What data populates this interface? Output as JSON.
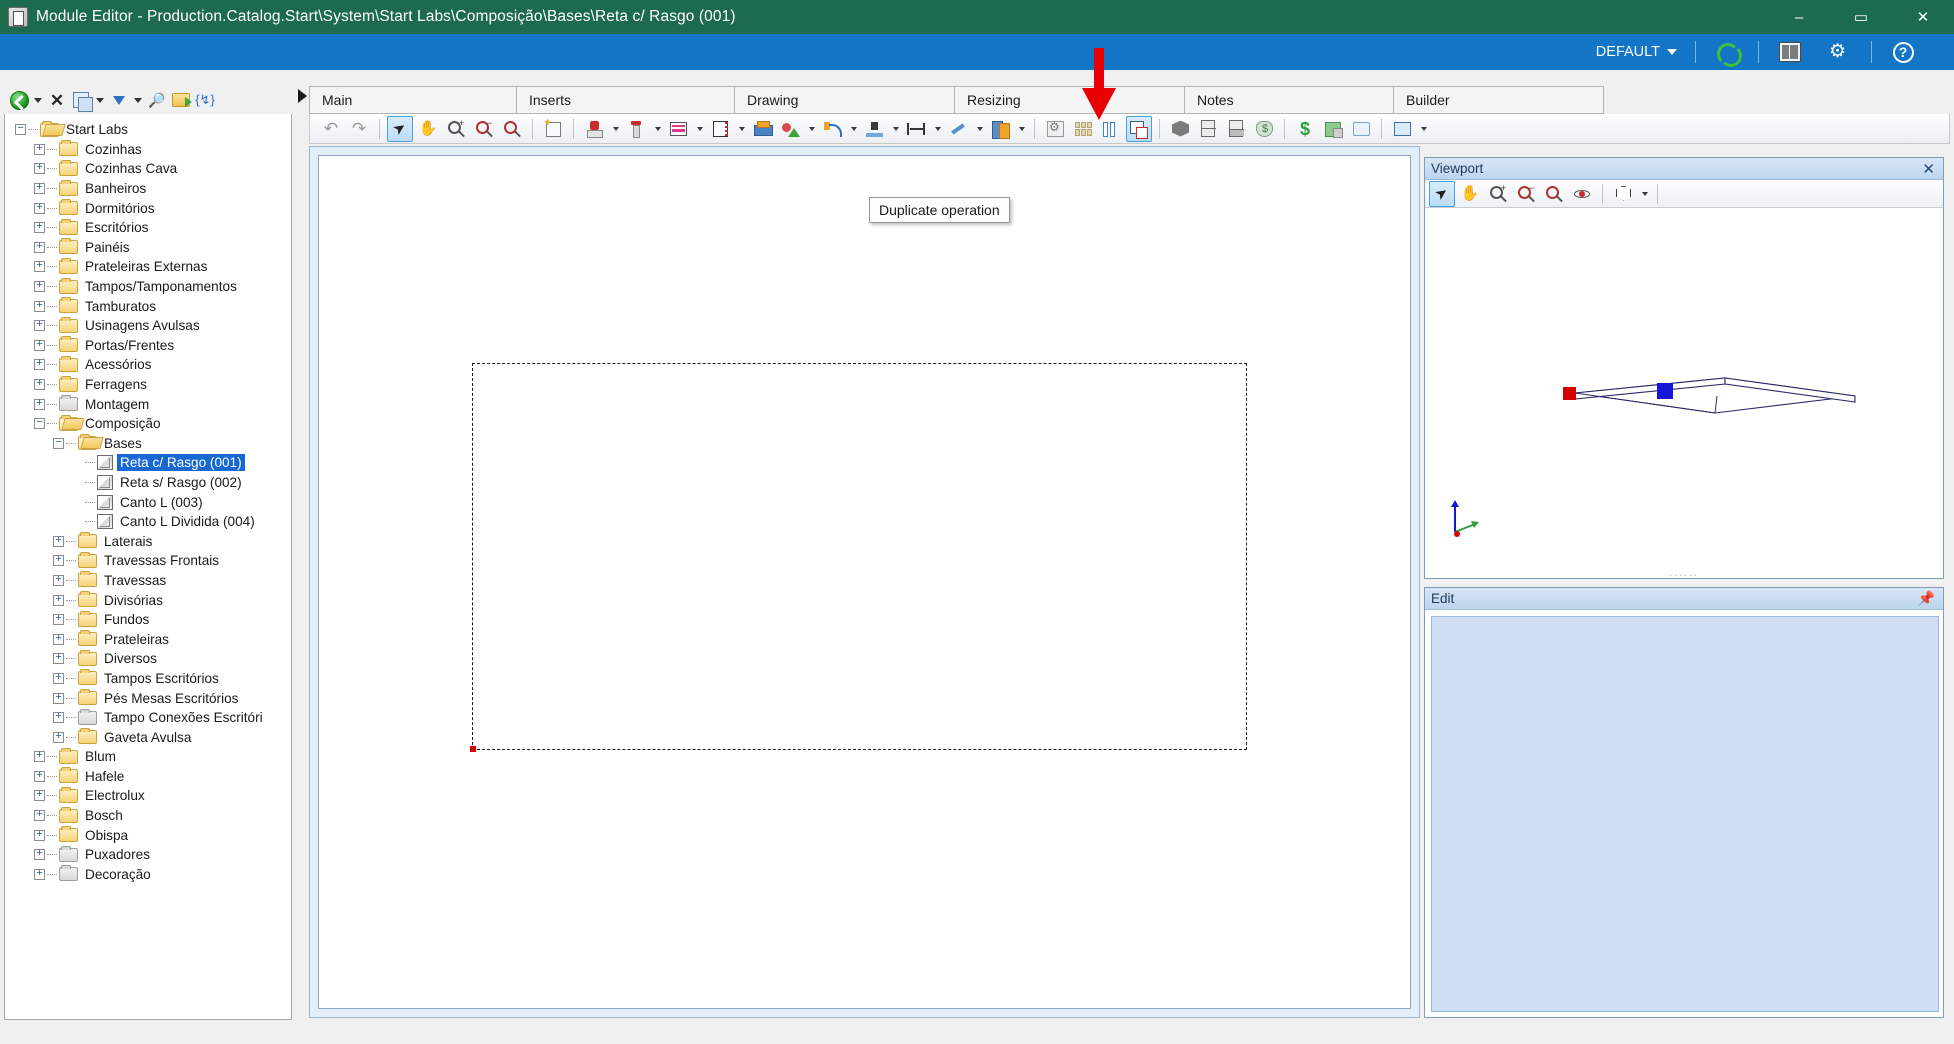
{
  "window": {
    "title": "Module Editor - Production.Catalog.Start\\System\\Start Labs\\Composição\\Bases\\Reta c/ Rasgo (001)",
    "app_icon": "module-editor-icon",
    "minimize": "–",
    "maximize": "▭",
    "close": "✕"
  },
  "ribbon": {
    "profile": "DEFAULT",
    "sync_icon": "sync-icon",
    "properties_icon": "properties-grid-icon",
    "settings_icon": "gear-icon",
    "help_icon": "help-icon"
  },
  "tree_toolbar": {
    "back": "back-navigate-icon",
    "back_caret": "▾",
    "delete": "✕",
    "copy": "copy-icon",
    "copy_caret": "▾",
    "move_down": "move-down-icon",
    "move_caret": "▾",
    "find": "binoculars-icon",
    "export_folder": "folder-export-icon",
    "variables": "variables-icon"
  },
  "tree": {
    "items": [
      {
        "label": "Start Labs",
        "depth": 0,
        "icon": "folder-open",
        "expander": "minus",
        "selected": false
      },
      {
        "label": "Cozinhas",
        "depth": 1,
        "icon": "folder",
        "expander": "plus",
        "selected": false
      },
      {
        "label": "Cozinhas Cava",
        "depth": 1,
        "icon": "folder",
        "expander": "plus",
        "selected": false
      },
      {
        "label": "Banheiros",
        "depth": 1,
        "icon": "folder",
        "expander": "plus",
        "selected": false
      },
      {
        "label": "Dormitórios",
        "depth": 1,
        "icon": "folder",
        "expander": "plus",
        "selected": false
      },
      {
        "label": "Escritórios",
        "depth": 1,
        "icon": "folder",
        "expander": "plus",
        "selected": false
      },
      {
        "label": "Painéis",
        "depth": 1,
        "icon": "folder",
        "expander": "plus",
        "selected": false
      },
      {
        "label": "Prateleiras Externas",
        "depth": 1,
        "icon": "folder",
        "expander": "plus",
        "selected": false
      },
      {
        "label": "Tampos/Tamponamentos",
        "depth": 1,
        "icon": "folder",
        "expander": "plus",
        "selected": false
      },
      {
        "label": "Tamburatos",
        "depth": 1,
        "icon": "folder",
        "expander": "plus",
        "selected": false
      },
      {
        "label": "Usinagens Avulsas",
        "depth": 1,
        "icon": "folder",
        "expander": "plus",
        "selected": false
      },
      {
        "label": "Portas/Frentes",
        "depth": 1,
        "icon": "folder",
        "expander": "plus",
        "selected": false
      },
      {
        "label": "Acessórios",
        "depth": 1,
        "icon": "folder",
        "expander": "plus",
        "selected": false
      },
      {
        "label": "Ferragens",
        "depth": 1,
        "icon": "folder",
        "expander": "plus",
        "selected": false
      },
      {
        "label": "Montagem",
        "depth": 1,
        "icon": "folder-grey",
        "expander": "plus",
        "selected": false
      },
      {
        "label": "Composição",
        "depth": 1,
        "icon": "folder-open",
        "expander": "minus",
        "selected": false
      },
      {
        "label": "Bases",
        "depth": 2,
        "icon": "folder-open",
        "expander": "minus",
        "selected": false
      },
      {
        "label": "Reta c/ Rasgo (001)",
        "depth": 3,
        "icon": "module-cube",
        "expander": "none",
        "selected": true
      },
      {
        "label": "Reta s/ Rasgo (002)",
        "depth": 3,
        "icon": "module-cube",
        "expander": "none",
        "selected": false
      },
      {
        "label": "Canto L (003)",
        "depth": 3,
        "icon": "module-cube",
        "expander": "none",
        "selected": false
      },
      {
        "label": "Canto L Dividida (004)",
        "depth": 3,
        "icon": "module-cube",
        "expander": "none",
        "selected": false
      },
      {
        "label": "Laterais",
        "depth": 2,
        "icon": "folder",
        "expander": "plus",
        "selected": false
      },
      {
        "label": "Travessas Frontais",
        "depth": 2,
        "icon": "folder",
        "expander": "plus",
        "selected": false
      },
      {
        "label": "Travessas",
        "depth": 2,
        "icon": "folder",
        "expander": "plus",
        "selected": false
      },
      {
        "label": "Divisórias",
        "depth": 2,
        "icon": "folder",
        "expander": "plus",
        "selected": false
      },
      {
        "label": "Fundos",
        "depth": 2,
        "icon": "folder",
        "expander": "plus",
        "selected": false
      },
      {
        "label": "Prateleiras",
        "depth": 2,
        "icon": "folder",
        "expander": "plus",
        "selected": false
      },
      {
        "label": "Diversos",
        "depth": 2,
        "icon": "folder",
        "expander": "plus",
        "selected": false
      },
      {
        "label": "Tampos Escritórios",
        "depth": 2,
        "icon": "folder",
        "expander": "plus",
        "selected": false
      },
      {
        "label": "Pés Mesas Escritórios",
        "depth": 2,
        "icon": "folder",
        "expander": "plus",
        "selected": false
      },
      {
        "label": "Tampo Conexões Escritóri",
        "depth": 2,
        "icon": "folder-grey",
        "expander": "plus",
        "selected": false
      },
      {
        "label": "Gaveta Avulsa",
        "depth": 2,
        "icon": "folder",
        "expander": "plus",
        "selected": false
      },
      {
        "label": "Blum",
        "depth": 1,
        "icon": "folder",
        "expander": "plus",
        "selected": false
      },
      {
        "label": "Hafele",
        "depth": 1,
        "icon": "folder",
        "expander": "plus",
        "selected": false
      },
      {
        "label": "Electrolux",
        "depth": 1,
        "icon": "folder",
        "expander": "plus",
        "selected": false
      },
      {
        "label": "Bosch",
        "depth": 1,
        "icon": "folder",
        "expander": "plus",
        "selected": false
      },
      {
        "label": "Obispa",
        "depth": 1,
        "icon": "folder",
        "expander": "plus",
        "selected": false
      },
      {
        "label": "Puxadores",
        "depth": 1,
        "icon": "folder-grey",
        "expander": "plus",
        "selected": false
      },
      {
        "label": "Decoração",
        "depth": 1,
        "icon": "folder-grey",
        "expander": "plus",
        "selected": false
      }
    ]
  },
  "tabs": [
    {
      "label": "Main",
      "active": true
    },
    {
      "label": "Inserts",
      "active": false
    },
    {
      "label": "Drawing",
      "active": false
    },
    {
      "label": "Resizing",
      "active": false
    },
    {
      "label": "Notes",
      "active": false
    },
    {
      "label": "Builder",
      "active": false
    }
  ],
  "toolbar": {
    "buttons": [
      {
        "name": "undo-icon",
        "glyph": "↶",
        "kind": "undo",
        "active": false,
        "caret": false
      },
      {
        "name": "redo-icon",
        "glyph": "↷",
        "kind": "redo",
        "active": false,
        "caret": false
      },
      {
        "name": "select-arrow-icon",
        "kind": "cursor",
        "active": true,
        "caret": false
      },
      {
        "name": "pan-hand-icon",
        "kind": "hand",
        "active": false,
        "caret": false
      },
      {
        "name": "zoom-in-icon",
        "kind": "zoomin",
        "active": false,
        "caret": false
      },
      {
        "name": "zoom-out-icon",
        "kind": "zoomout",
        "active": false,
        "caret": false
      },
      {
        "name": "zoom-actual-icon",
        "kind": "zoomone",
        "active": false,
        "caret": false
      },
      {
        "name": "new-module-icon",
        "kind": "newsq",
        "active": false,
        "caret": false
      },
      {
        "name": "drill-operation-icon",
        "kind": "drill",
        "active": false,
        "caret": true
      },
      {
        "name": "screw-operation-icon",
        "kind": "screw",
        "active": false,
        "caret": true
      },
      {
        "name": "edge-band-icon",
        "kind": "stripes",
        "active": false,
        "caret": true
      },
      {
        "name": "panel-icon",
        "kind": "panel",
        "active": false,
        "caret": true
      },
      {
        "name": "insert-part-icon",
        "kind": "printer",
        "active": false,
        "caret": false
      },
      {
        "name": "shape-insert-icon",
        "kind": "shape3d",
        "active": false,
        "caret": true
      },
      {
        "name": "curve-operation-icon",
        "kind": "curve",
        "active": false,
        "caret": true
      },
      {
        "name": "point-operation-icon",
        "kind": "pointdown",
        "active": false,
        "caret": true
      },
      {
        "name": "dimension-icon",
        "kind": "dimension",
        "active": false,
        "caret": true
      },
      {
        "name": "line-tool-icon",
        "kind": "pencil",
        "active": false,
        "caret": true
      },
      {
        "name": "library-icon",
        "kind": "books",
        "active": false,
        "caret": true
      },
      {
        "name": "settings-page-icon",
        "kind": "gearpage",
        "active": false,
        "caret": false
      },
      {
        "name": "blocks-icon",
        "kind": "blocks",
        "active": false,
        "caret": false
      },
      {
        "name": "columns-icon",
        "kind": "bluebars",
        "active": false,
        "caret": false
      },
      {
        "name": "duplicate-operation-icon",
        "kind": "dupe",
        "active": true,
        "caret": false
      },
      {
        "name": "cube-3d-icon",
        "kind": "cube3",
        "active": false,
        "caret": false
      },
      {
        "name": "door-cabinet-icon",
        "kind": "doorcab",
        "active": false,
        "caret": false
      },
      {
        "name": "drawer-cabinet-icon",
        "kind": "drawercab",
        "active": false,
        "caret": false
      },
      {
        "name": "cost-bag-icon",
        "kind": "moneybag",
        "active": false,
        "caret": false
      },
      {
        "name": "price-dollar-icon",
        "kind": "dollar",
        "active": false,
        "caret": false
      },
      {
        "name": "material-cube-icon",
        "kind": "greencube",
        "active": false,
        "caret": false
      },
      {
        "name": "catalog-book-icon",
        "kind": "book",
        "active": false,
        "caret": false
      },
      {
        "name": "preview-monitor-icon",
        "kind": "monitor",
        "active": false,
        "caret": true
      }
    ]
  },
  "canvas": {
    "tooltip": "Duplicate operation",
    "annotation_arrow": "red-down-arrow"
  },
  "viewport": {
    "title": "Viewport",
    "close": "✕",
    "toolbar": [
      {
        "name": "vp-select-arrow-icon",
        "kind": "cursor",
        "active": true,
        "caret": false
      },
      {
        "name": "vp-pan-hand-icon",
        "kind": "hand",
        "active": false,
        "caret": false
      },
      {
        "name": "vp-zoom-in-icon",
        "kind": "zoomin",
        "active": false,
        "caret": false
      },
      {
        "name": "vp-zoom-out-icon",
        "kind": "zoomout",
        "active": false,
        "caret": false
      },
      {
        "name": "vp-zoom-actual-icon",
        "kind": "zoomone",
        "active": false,
        "caret": false
      },
      {
        "name": "vp-orbit-icon",
        "kind": "orbit",
        "active": false,
        "caret": false
      },
      {
        "name": "vp-view-cube-icon",
        "kind": "viewcube",
        "active": false,
        "caret": true
      }
    ]
  },
  "edit": {
    "title": "Edit",
    "pin": "pin-icon"
  }
}
